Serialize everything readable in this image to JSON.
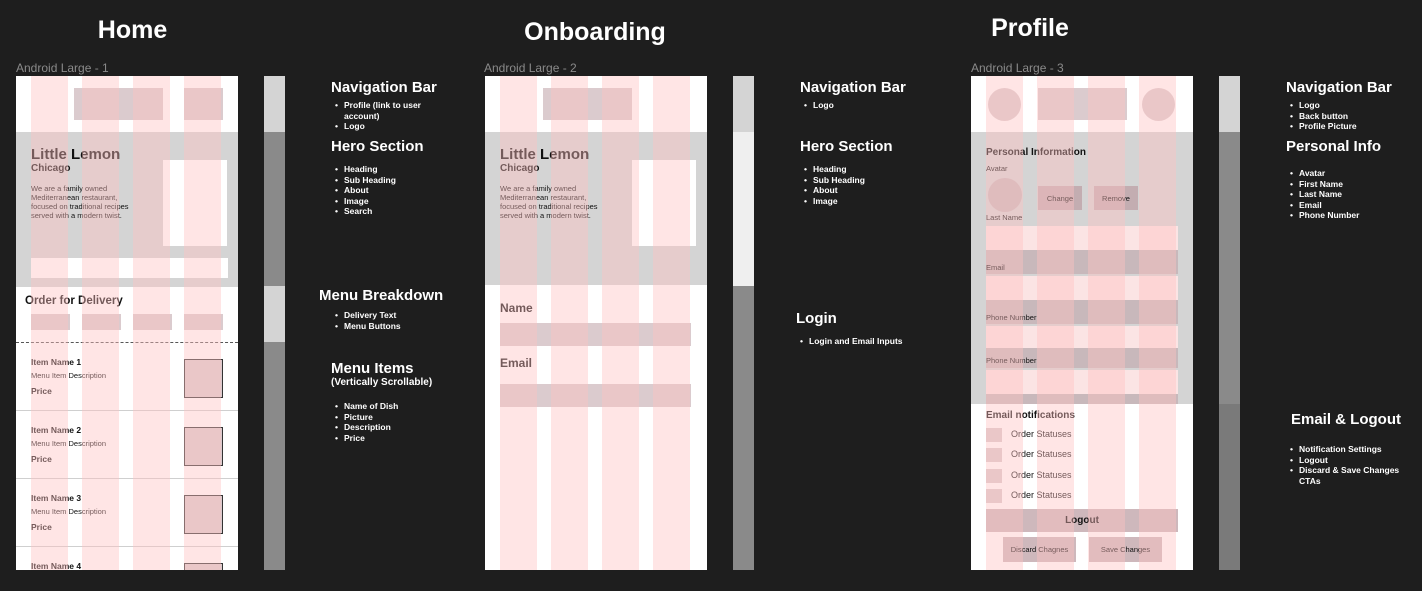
{
  "sections": {
    "home": "Home",
    "onboarding": "Onboarding",
    "profile": "Profile"
  },
  "frames": {
    "home": "Android Large - 1",
    "onboarding": "Android Large - 2",
    "profile": "Android Large - 3"
  },
  "hero": {
    "title": "Little Lemon",
    "city": "Chicago",
    "description": "We are a family owned Mediterranean restaurant, focused on traditional recipes served with a modern twist."
  },
  "home": {
    "delivery": "Order for Delivery",
    "items": [
      {
        "name": "Item Name 1",
        "desc": "Menu Item Description",
        "price": "Price"
      },
      {
        "name": "Item Name 2",
        "desc": "Menu Item Description",
        "price": "Price"
      },
      {
        "name": "Item Name 3",
        "desc": "Menu Item Description",
        "price": "Price"
      },
      {
        "name": "Item Name 4"
      }
    ]
  },
  "onboarding": {
    "name_label": "Name",
    "email_label": "Email"
  },
  "profile": {
    "personal_info": "Personal Information",
    "avatar": "Avatar",
    "change": "Change",
    "remove": "Remove",
    "last_name": "Last Name",
    "email": "Email",
    "phone1": "Phone Number",
    "phone2": "Phone Number",
    "email_notifications": "Email notifications",
    "statuses": [
      "Order Statuses",
      "Order Statuses",
      "Order Statuses",
      "Order Statuses"
    ],
    "logout": "Logout",
    "discard": "Discard Chagnes",
    "save": "Save Changes"
  },
  "annotations": {
    "home": {
      "nav_title": "Navigation Bar",
      "nav_items": [
        "Profile (link to user account)",
        "Logo"
      ],
      "hero_title": "Hero Section",
      "hero_items": [
        "Heading",
        "Sub Heading",
        "About",
        "Image",
        "Search"
      ],
      "menu_title": "Menu Breakdown",
      "menu_items": [
        "Delivery Text",
        "Menu Buttons"
      ],
      "items_title": "Menu Items",
      "items_sub": "(Vertically Scrollable)",
      "items_items": [
        "Name of Dish",
        "Picture",
        "Description",
        "Price"
      ]
    },
    "onboarding": {
      "nav_title": "Navigation Bar",
      "nav_items": [
        "Logo"
      ],
      "hero_title": "Hero Section",
      "hero_items": [
        "Heading",
        "Sub Heading",
        "About",
        "Image"
      ],
      "login_title": "Login",
      "login_items": [
        "Login and Email Inputs"
      ]
    },
    "profile": {
      "nav_title": "Navigation Bar",
      "nav_items": [
        "Logo",
        "Back button",
        "Profile Picture"
      ],
      "info_title": "Personal Info",
      "info_items": [
        "Avatar",
        "First Name",
        "Last Name",
        "Email",
        "Phone Number"
      ],
      "logout_title": "Email & Logout",
      "logout_items": [
        "Notification Settings",
        "Logout",
        "Discard & Save Changes CTAs"
      ]
    }
  }
}
